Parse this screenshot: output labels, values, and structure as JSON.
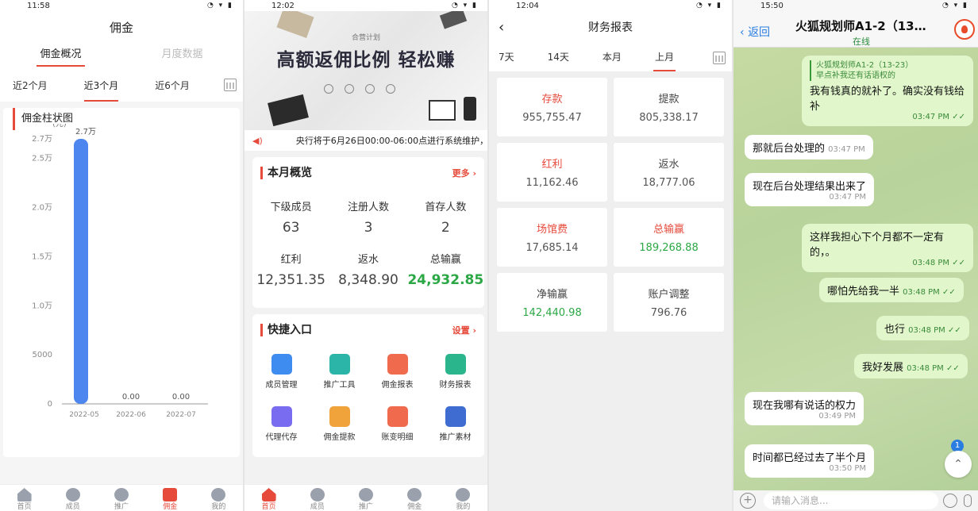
{
  "panel1": {
    "time": "11:58",
    "title": "佣金",
    "tabs": [
      "佣金概况",
      "月度数据"
    ],
    "ranges": [
      "近2个月",
      "近3个月",
      "近6个月"
    ],
    "card_title": "佣金柱状图",
    "tabbar": [
      "首页",
      "成员",
      "推广",
      "佣金",
      "我的"
    ],
    "chart_data": {
      "type": "bar",
      "categories": [
        "2022-05",
        "2022-06",
        "2022-07"
      ],
      "values": [
        27000,
        0,
        0
      ],
      "value_labels": [
        "2.7万",
        "0.00",
        "0.00"
      ],
      "y_ticks": [
        0,
        5000,
        10000,
        15000,
        20000,
        25000,
        27000
      ],
      "y_tick_labels": [
        "0",
        "5000",
        "1.0万",
        "1.5万",
        "2.0万",
        "2.5万",
        "2.7万"
      ],
      "ylabel": "(元)",
      "ylim": [
        0,
        27000
      ],
      "grid": false,
      "bar_color": "#4e86f0"
    }
  },
  "panel2": {
    "time": "12:02",
    "banner_sub": "合营计划",
    "banner_title": "高额返佣比例 轻松赚",
    "notice": "央行将于6月26日00:00-06:00点进行系统维护，",
    "overview": {
      "title": "本月概览",
      "more": "更多",
      "items": [
        {
          "label": "下级成员",
          "value": "63"
        },
        {
          "label": "注册人数",
          "value": "3"
        },
        {
          "label": "首存人数",
          "value": "2"
        },
        {
          "label": "红利",
          "value": "12,351.35"
        },
        {
          "label": "返水",
          "value": "8,348.90"
        },
        {
          "label": "总输赢",
          "value": "24,932.85"
        }
      ]
    },
    "quick": {
      "title": "快捷入口",
      "setting": "设置",
      "items": [
        {
          "label": "成员管理",
          "color": "#3f8cf0"
        },
        {
          "label": "推广工具",
          "color": "#2bb5a8"
        },
        {
          "label": "佣金报表",
          "color": "#f06a4e"
        },
        {
          "label": "财务报表",
          "color": "#2bb58c"
        },
        {
          "label": "代理代存",
          "color": "#7a6cf0"
        },
        {
          "label": "佣金提款",
          "color": "#f0a23b"
        },
        {
          "label": "账变明细",
          "color": "#f06a4e"
        },
        {
          "label": "推广素材",
          "color": "#3f6cd0"
        }
      ]
    },
    "tabbar": [
      "首页",
      "成员",
      "推广",
      "佣金",
      "我的"
    ]
  },
  "panel3": {
    "time": "12:04",
    "title": "财务报表",
    "ranges": [
      "7天",
      "14天",
      "本月",
      "上月"
    ],
    "items": [
      {
        "label": "存款",
        "value": "955,755.47",
        "label_red": true,
        "green": false
      },
      {
        "label": "提款",
        "value": "805,338.17",
        "label_red": false,
        "green": false
      },
      {
        "label": "红利",
        "value": "11,162.46",
        "label_red": true,
        "green": false
      },
      {
        "label": "返水",
        "value": "18,777.06",
        "label_red": false,
        "green": false
      },
      {
        "label": "场馆费",
        "value": "17,685.14",
        "label_red": true,
        "green": false
      },
      {
        "label": "总输赢",
        "value": "189,268.88",
        "label_red": true,
        "green": true
      },
      {
        "label": "净输赢",
        "value": "142,440.98",
        "label_red": false,
        "green": true
      },
      {
        "label": "账户调整",
        "value": "796.76",
        "label_red": false,
        "green": false
      }
    ]
  },
  "panel4": {
    "time": "15:50",
    "back": "返回",
    "name": "火狐规划师A1-2（13…",
    "status": "在线",
    "input_placeholder": "请输入消息...",
    "badge": "1",
    "messages": [
      {
        "reply_name": "火狐规划师A1-2（13-23）",
        "reply_text": "早点补我还有话语权的",
        "text": "我有钱真的就补了。确实没有钱给补",
        "time": "03:47 PM ✓✓"
      },
      {
        "text": "那就后台处理的",
        "time": "03:47 PM"
      },
      {
        "text": "现在后台处理结果出来了",
        "time": "03:47 PM"
      },
      {
        "text": "这样我担心下个月都不一定有的，。",
        "time": "03:48 PM ✓✓"
      },
      {
        "text": "哪怕先给我一半",
        "time": "03:48 PM ✓✓"
      },
      {
        "text": "也行",
        "time": "03:48 PM ✓✓"
      },
      {
        "text": "我好发展",
        "time": "03:48 PM ✓✓"
      },
      {
        "text": "现在我哪有说话的权力",
        "time": "03:49 PM"
      },
      {
        "text": "时间都已经过去了半个月",
        "time": "03:50 PM"
      }
    ]
  }
}
